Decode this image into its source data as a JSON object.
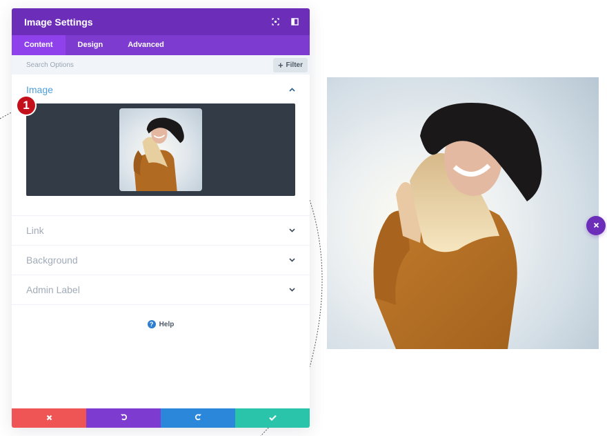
{
  "modal": {
    "title": "Image Settings",
    "header_icons": [
      "fullscreen-icon",
      "sidebar-toggle-icon"
    ],
    "tabs": [
      {
        "label": "Content",
        "active": true
      },
      {
        "label": "Design",
        "active": false
      },
      {
        "label": "Advanced",
        "active": false
      }
    ],
    "search": {
      "placeholder": "Search Options",
      "value": ""
    },
    "filter_label": "Filter",
    "sections": [
      {
        "title": "Image",
        "open": true
      },
      {
        "title": "Link",
        "open": false
      },
      {
        "title": "Background",
        "open": false
      },
      {
        "title": "Admin Label",
        "open": false
      }
    ],
    "help_label": "Help",
    "footer": {
      "buttons": [
        {
          "action": "cancel",
          "icon": "close-icon",
          "color": "#ef5555"
        },
        {
          "action": "undo",
          "icon": "undo-icon",
          "color": "#7e3bd0"
        },
        {
          "action": "redo",
          "icon": "redo-icon",
          "color": "#2b87da"
        },
        {
          "action": "save",
          "icon": "check-icon",
          "color": "#29c4a9"
        }
      ]
    }
  },
  "annotation": {
    "step": "1",
    "color": "#c4101b"
  },
  "image": {
    "description": "Smiling woman with black wide-brim hat and mustard knit sweater against bright sky"
  },
  "colors": {
    "header": "#6c2eb9",
    "tabs": "#7e3bd0",
    "active_tab": "#8f42ec",
    "section_active": "#2e8ed2",
    "upload_bg": "#333b47"
  }
}
